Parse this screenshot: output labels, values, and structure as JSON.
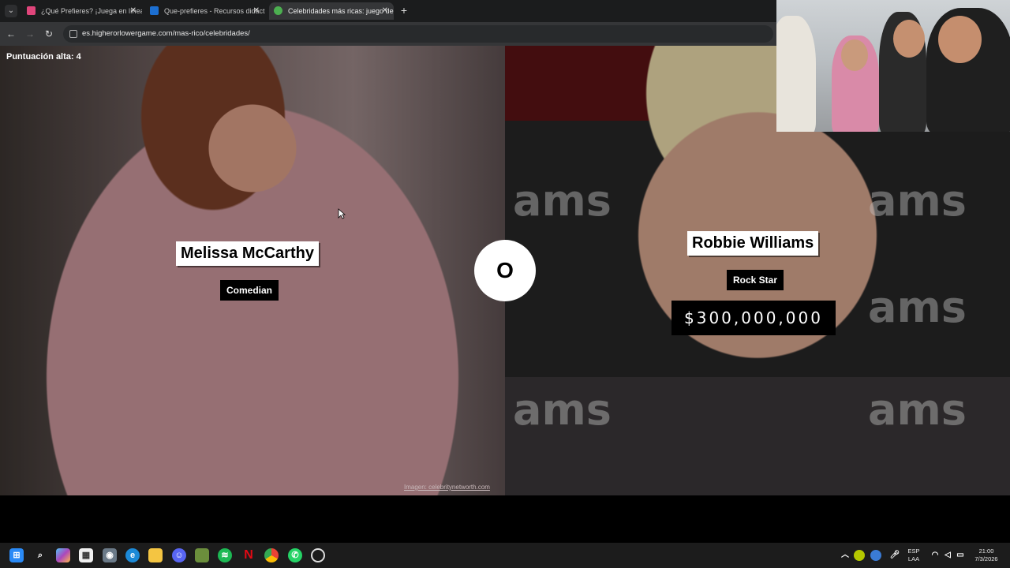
{
  "browser": {
    "tabs": [
      {
        "label": "¿Qué Prefieres? ¡Juega en línea!",
        "favicon_color": "#e0457b"
      },
      {
        "label": "Que-prefieres - Recursos didáctico",
        "favicon_color": "#1c6fd1"
      },
      {
        "label": "Celebridades más ricas: juego de",
        "favicon_color": "#4caf50"
      }
    ],
    "url": "es.higherorlowergame.com/mas-rico/celebridades/"
  },
  "game": {
    "high_score_label": "Puntuación alta: 4",
    "left": {
      "name": "Melissa McCarthy",
      "job": "Comedian"
    },
    "right": {
      "name": "Robbie Williams",
      "job": "Rock Star",
      "value": "$300,000,000"
    },
    "vs_symbol": "O",
    "image_credit": "Imagen: celebritynetworth.com",
    "background_word": "ams"
  },
  "taskbar": {
    "language": "ESP",
    "layout": "LAA",
    "time": "21:00",
    "date": "7/3/2026",
    "icons": [
      "windows-start-icon",
      "search-icon",
      "copilot-icon",
      "store-icon",
      "camera-icon",
      "edge-icon",
      "file-explorer-icon",
      "discord-icon",
      "minecraft-icon",
      "spotify-icon",
      "netflix-icon",
      "chrome-icon",
      "whatsapp-icon",
      "obs-icon"
    ]
  }
}
